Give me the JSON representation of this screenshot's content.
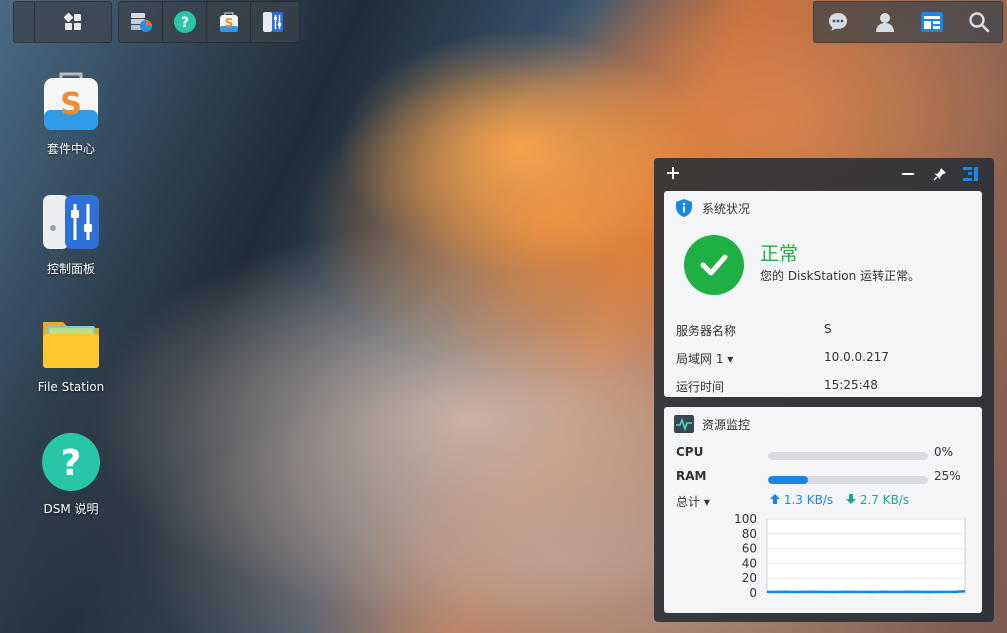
{
  "taskbar": {
    "left_buttons": [
      "main-menu",
      "storage-manager",
      "dsm-help",
      "package-center",
      "control-panel"
    ]
  },
  "desktop": {
    "icons": [
      {
        "label": "套件中心"
      },
      {
        "label": "控制面板"
      },
      {
        "label": "File Station"
      },
      {
        "label": "DSM 说明"
      }
    ]
  },
  "widgets": {
    "system_status": {
      "title": "系统状况",
      "status": "正常",
      "message": "您的 DiskStation 运转正常。",
      "rows": [
        {
          "key": "服务器名称",
          "value": "S"
        },
        {
          "key": "局域网 1 ▾",
          "value": "10.0.0.217"
        },
        {
          "key": "运行时间",
          "value": "15:25:48"
        }
      ]
    },
    "resource_monitor": {
      "title": "资源监控",
      "cpu_label": "CPU",
      "cpu_value": "0%",
      "cpu_fraction": 0.0,
      "ram_label": "RAM",
      "ram_value": "25%",
      "ram_fraction": 0.25,
      "net_label": "总计 ▾",
      "upload": "1.3 KB/s",
      "download": "2.7 KB/s"
    }
  },
  "chart_data": {
    "type": "line",
    "title": "",
    "xlabel": "",
    "ylabel": "",
    "ylim": [
      0,
      100
    ],
    "yticks": [
      100,
      80,
      60,
      40,
      20,
      0
    ],
    "series": [
      {
        "values": [
          1.5,
          1.5,
          1.6,
          1.4,
          1.5,
          1.6,
          1.5,
          1.4,
          1.5,
          1.6,
          1.5,
          1.5,
          1.4,
          1.6,
          1.5,
          1.5,
          1.6,
          1.5,
          1.4,
          1.5,
          1.5,
          1.6,
          2.5
        ]
      }
    ],
    "grid": true,
    "colors": {
      "line": "#1a86e8"
    }
  }
}
